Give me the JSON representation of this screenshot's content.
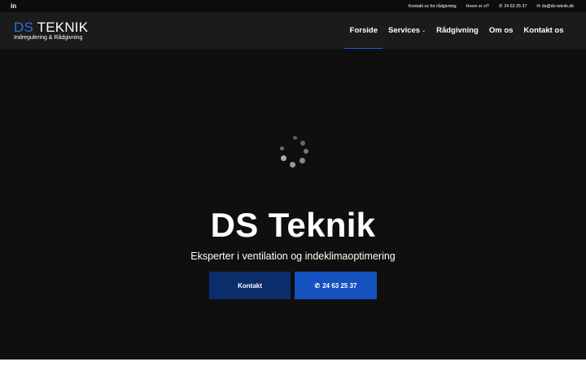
{
  "topbar": {
    "social_icon": "linkedin-icon",
    "social_label": "in",
    "links": {
      "consult": "Kontakt os for rådgivning",
      "who": "Hvem er vi?",
      "phone": "24 63 25 37",
      "email": "ds@ds-teknik.dk"
    },
    "phone_icon": "phone-icon",
    "email_icon": "envelope-icon"
  },
  "header": {
    "logo_ds": "DS",
    "logo_teknik": "TEKNIK",
    "logo_sub": "Indregulering & Rådgivning",
    "nav": {
      "home": "Forside",
      "services": "Services",
      "advice": "Rådgivning",
      "about": "Om os",
      "contact": "Kontakt os"
    },
    "active_item": "Forside"
  },
  "hero": {
    "title": "DS Teknik",
    "subtitle": "Eksperter i ventilation og indeklimaoptimering",
    "button_contact": "Kontakt",
    "button_phone": "24 63 25 37",
    "loader_icon": "loading-spinner-icon"
  },
  "colors": {
    "brand_blue": "#2f6fe4",
    "button_dark": "#0c2d6b",
    "button_blue": "#1552c0",
    "header_bg": "#1b1b1b",
    "hero_bg": "#0f0f0f"
  }
}
